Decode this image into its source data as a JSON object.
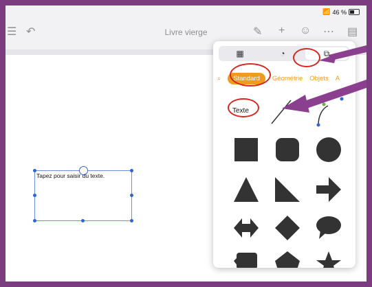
{
  "status": {
    "battery": "46 %"
  },
  "toolbar": {
    "title": "Livre vierge"
  },
  "canvas": {
    "placeholder_text": "Tapez pour saisir du texte."
  },
  "popover": {
    "categories": [
      "Standard",
      "Géométrie",
      "Objets",
      "A"
    ],
    "text_item_label": "Texte"
  },
  "colors": {
    "accent": "#f09a20",
    "annotation": "#d6261f",
    "arrow": "#8a3f8f",
    "frame": "#7b3d80"
  },
  "icons": [
    "table-icon",
    "clock-icon",
    "shapes-icon",
    "search-icon"
  ]
}
